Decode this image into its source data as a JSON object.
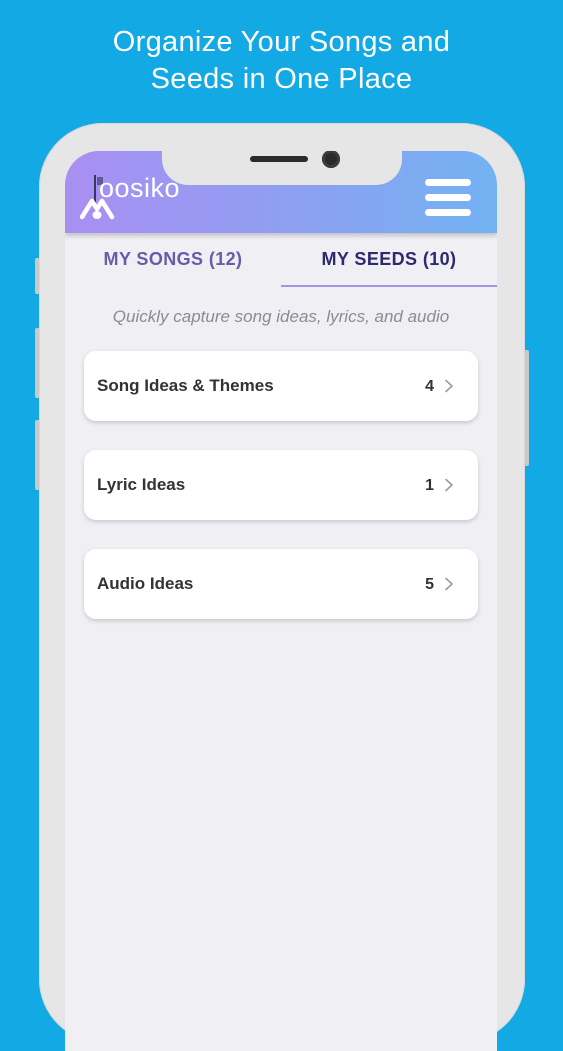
{
  "headline": {
    "line1": "Organize Your Songs and",
    "line2": "Seeds in One Place"
  },
  "app": {
    "name": "oosiko",
    "logo_icon": "moosiko-logo-icon",
    "header_gradient": [
      "#a98ff2",
      "#72b3f2"
    ],
    "menu_icon": "hamburger-menu-icon"
  },
  "tabs": [
    {
      "label": "MY SONGS (12)",
      "selected": false
    },
    {
      "label": "MY SEEDS (10)",
      "selected": true
    }
  ],
  "subtitle": "Quickly capture song ideas, lyrics, and audio",
  "seed_categories": [
    {
      "label": "Song Ideas & Themes",
      "count": "4"
    },
    {
      "label": "Lyric Ideas",
      "count": "1"
    },
    {
      "label": "Audio Ideas",
      "count": "5"
    }
  ],
  "colors": {
    "background": "#13a9e5",
    "tab_active": "#2e2a6e",
    "tab_inactive": "#6a5aa8",
    "tab_underline": "#a693e6"
  }
}
